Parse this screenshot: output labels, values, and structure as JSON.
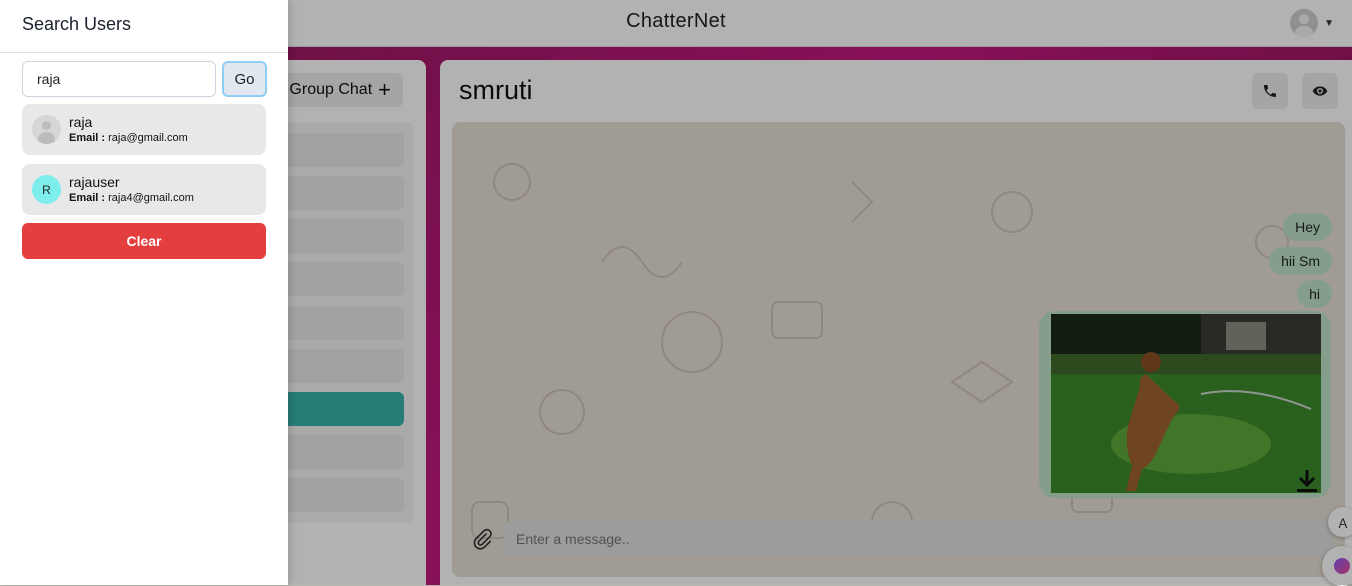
{
  "app": {
    "title": "ChatterNet"
  },
  "drawer": {
    "title": "Search Users",
    "search": {
      "value": "raja"
    },
    "go_label": "Go",
    "results": [
      {
        "name": "raja",
        "email_label": "Email :",
        "email": "raja@gmail.com",
        "avatar": "default-avatar"
      },
      {
        "name": "rajauser",
        "email_label": "Email :",
        "email": "raja4@gmail.com",
        "avatar_letter": "R"
      }
    ],
    "clear_label": "Clear"
  },
  "sidebar": {
    "group_chat_label": "Group Chat"
  },
  "chat": {
    "name": "smruti",
    "messages": [
      "Hey",
      "hii Sm",
      "hi"
    ],
    "input_placeholder": "Enter a message.."
  },
  "colors": {
    "accent": "#38b2ac",
    "clear": "#e53e3e",
    "bubble": "#bfe3c9"
  }
}
